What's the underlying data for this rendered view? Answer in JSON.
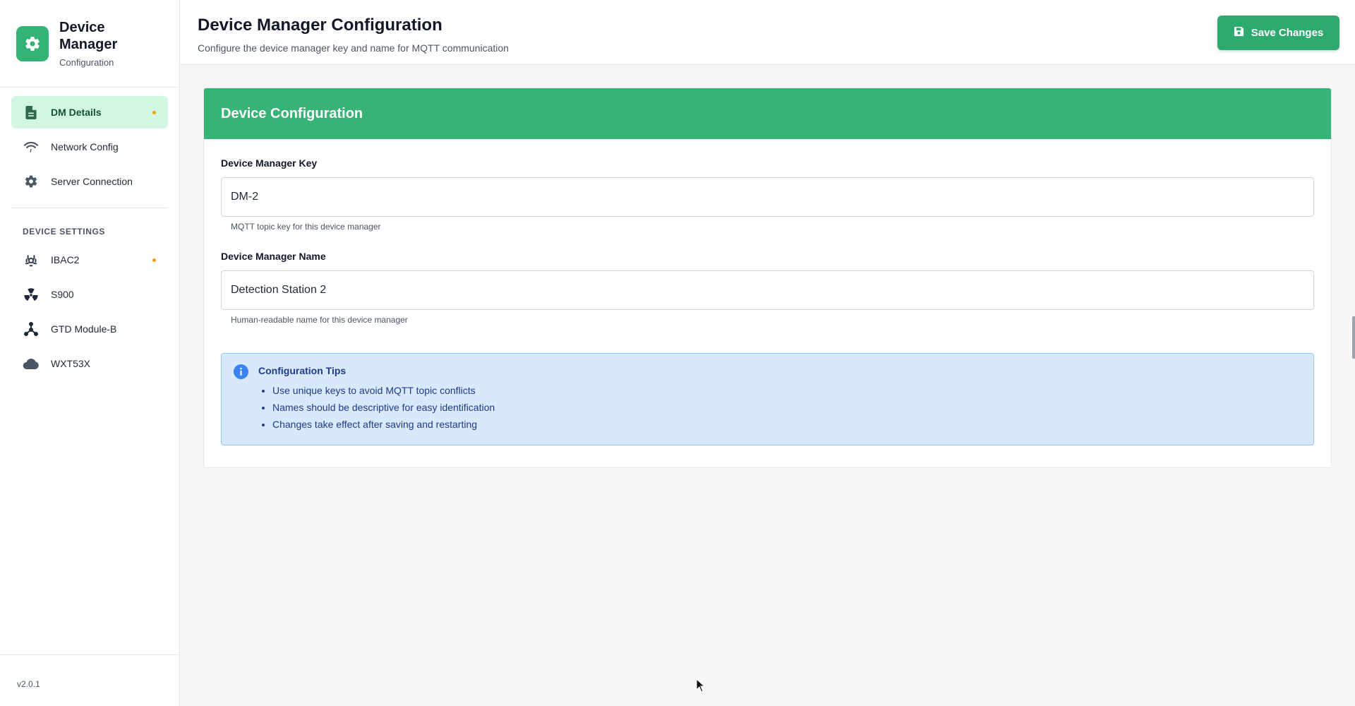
{
  "brand": {
    "title": "Device Manager",
    "subtitle": "Configuration",
    "accent": "#34b377"
  },
  "sidebar": {
    "nav_items": [
      {
        "label": "DM Details",
        "icon": "document-icon",
        "active": true,
        "has_dot": true
      },
      {
        "label": "Network Config",
        "icon": "wifi-icon",
        "active": false,
        "has_dot": false
      },
      {
        "label": "Server Connection",
        "icon": "gear-icon",
        "active": false,
        "has_dot": false
      }
    ],
    "section_label": "DEVICE SETTINGS",
    "device_items": [
      {
        "label": "IBAC2",
        "icon": "biohazard-icon",
        "has_dot": true
      },
      {
        "label": "S900",
        "icon": "radiation-icon",
        "has_dot": false
      },
      {
        "label": "GTD Module-B",
        "icon": "network-nodes-icon",
        "has_dot": false
      },
      {
        "label": "WXT53X",
        "icon": "cloud-icon",
        "has_dot": false
      }
    ],
    "version": "v2.0.1"
  },
  "header": {
    "title": "Device Manager Configuration",
    "subtitle": "Configure the device manager key and name for MQTT communication",
    "save_label": "Save Changes"
  },
  "card": {
    "title": "Device Configuration",
    "key_field": {
      "label": "Device Manager Key",
      "value": "DM-2",
      "help": "MQTT topic key for this device manager"
    },
    "name_field": {
      "label": "Device Manager Name",
      "value": "Detection Station 2",
      "help": "Human-readable name for this device manager"
    },
    "tips": {
      "title": "Configuration Tips",
      "items": [
        "Use unique keys to avoid MQTT topic conflicts",
        "Names should be descriptive for easy identification",
        "Changes take effect after saving and restarting"
      ]
    }
  },
  "colors": {
    "primary": "#2eaa6e",
    "active_bg": "#d1f7e2",
    "dot": "#f59e0b",
    "info_bg": "#d8e8fd",
    "info_text": "#1e3a8a"
  }
}
